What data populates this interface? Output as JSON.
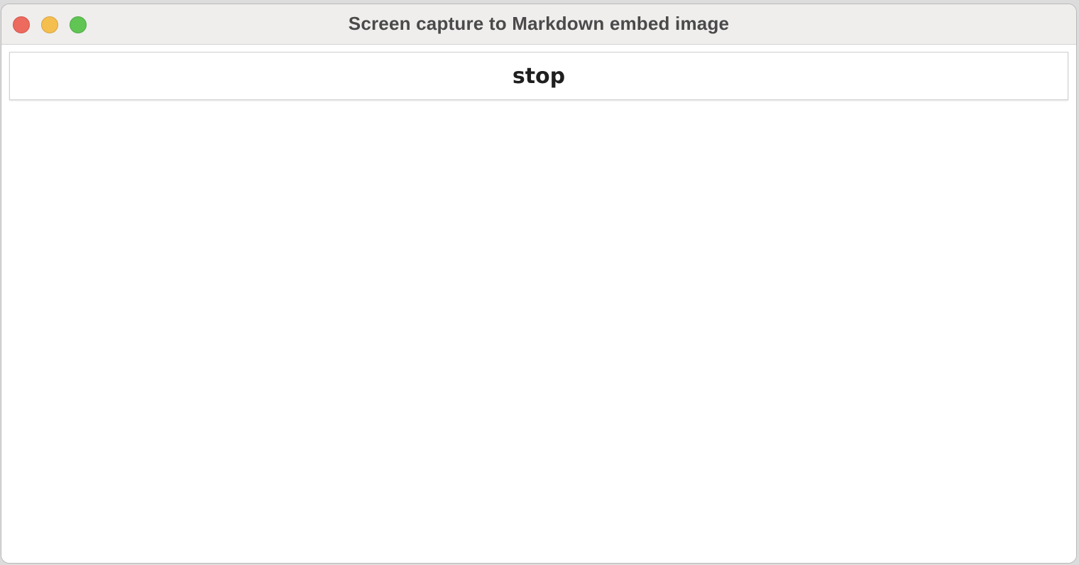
{
  "window": {
    "title": "Screen capture to Markdown embed image"
  },
  "traffic_lights": {
    "close": {
      "icon": "close-traffic-light",
      "color": "#ed6a5e"
    },
    "minimize": {
      "icon": "minimize-traffic-light",
      "color": "#f5bf4f"
    },
    "zoom": {
      "icon": "zoom-traffic-light",
      "color": "#61c554"
    }
  },
  "content": {
    "stop_label": "stop"
  }
}
